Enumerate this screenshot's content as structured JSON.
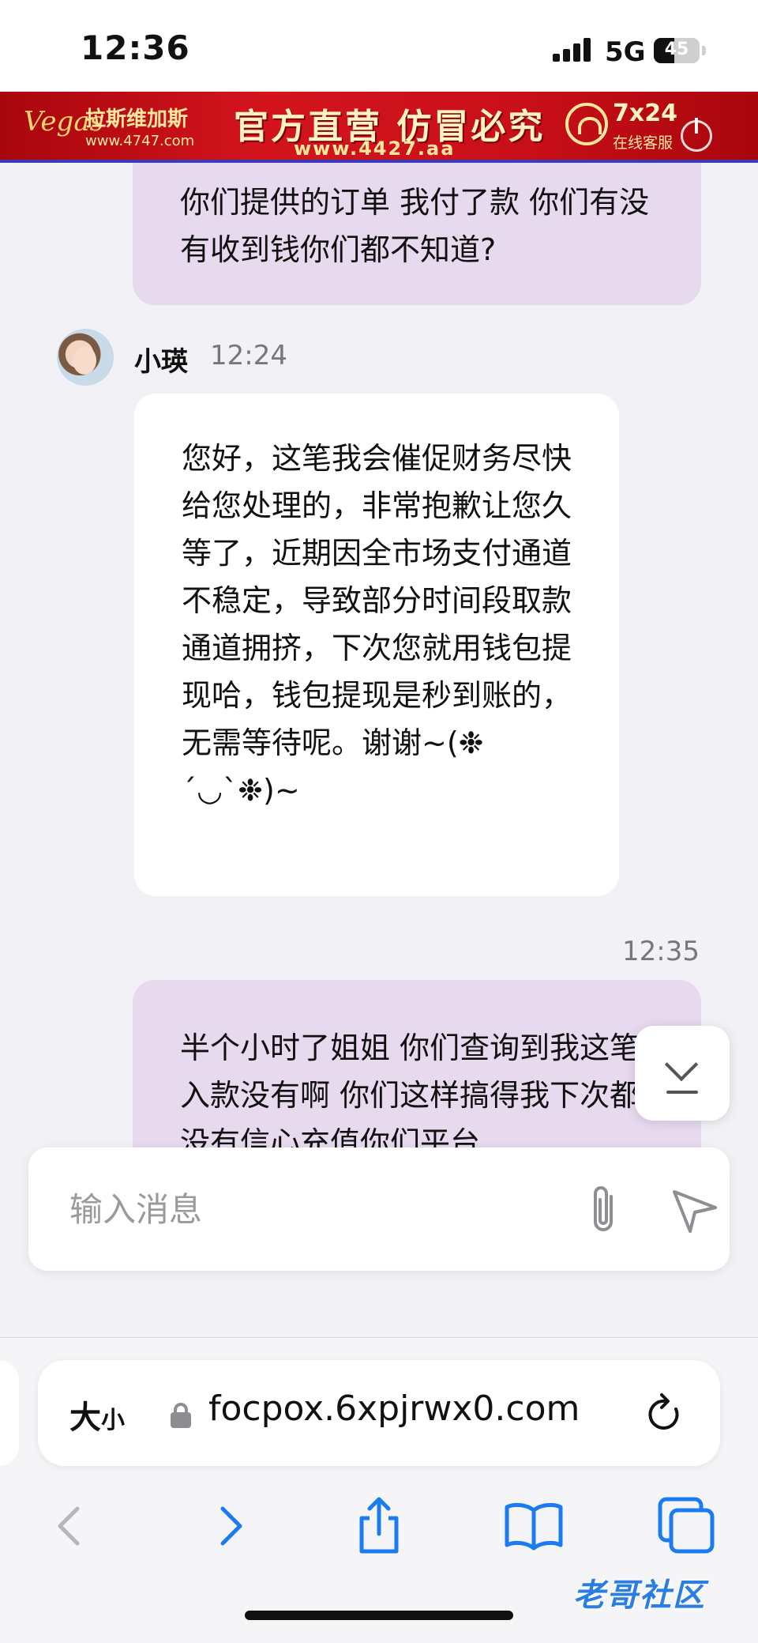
{
  "status_bar": {
    "time": "12:36",
    "network": "5G",
    "battery": "45",
    "battery_level": 0.45
  },
  "ad_banner": {
    "logo": "Vegas",
    "brand": "拉斯维加斯",
    "url_small": "www.4747.com",
    "slogan": "官方直营 仿冒必究",
    "url_large": "www.4427.aa",
    "hours": "7x24",
    "service_label": "在线客服"
  },
  "chat": {
    "messages": [
      {
        "direction": "out",
        "text": "你们提供的订单 我付了款 你们有没有收到钱你们都不知道?"
      },
      {
        "direction": "in",
        "sender": "小瑛",
        "time": "12:24",
        "text": "您好，这笔我会催促财务尽快给您处理的，非常抱歉让您久等了，近期因全市场支付通道不稳定，导致部分时间段取款通道拥挤，下次您就用钱包提现哈，钱包提现是秒到账的，无需等待呢。谢谢~(❉´◡`❉)~"
      },
      {
        "direction": "out",
        "time": "12:35",
        "text": "半个小时了姐姐 你们查询到我这笔入款没有啊 你们这样搞得我下次都没有信心充值你们平台"
      }
    ]
  },
  "composer": {
    "placeholder": "输入消息"
  },
  "browser": {
    "text_size_label_big": "大",
    "text_size_label_small": "小",
    "url": "focpox.6xpjrwx0.com"
  },
  "watermark": "老哥社区"
}
